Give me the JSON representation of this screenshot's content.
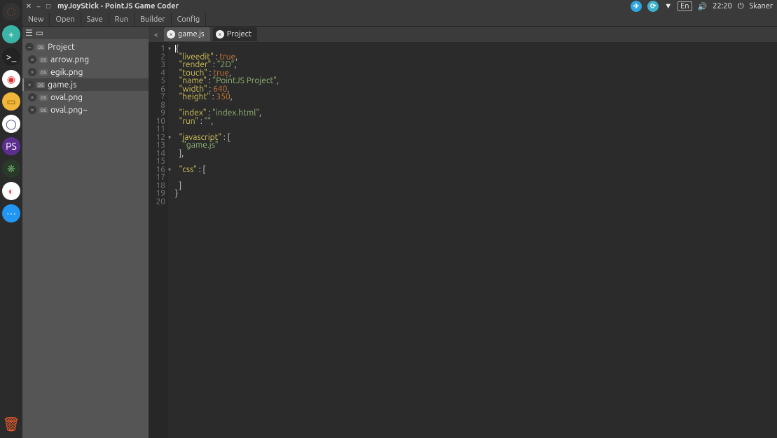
{
  "window": {
    "title": "myJoyStick - PointJS Game Coder",
    "controls": {
      "close": "✕",
      "min": "–",
      "max": "□"
    }
  },
  "system_tray": {
    "telegram_color": "#2ea6df",
    "sync_color": "#3db1c9",
    "wifi": "▾",
    "lang": "En",
    "volume": "🔊",
    "time": "22:20",
    "power": "⏻",
    "user": "Skaner"
  },
  "menubar": [
    "New",
    "Open",
    "Save",
    "Run",
    "Builder",
    "Config"
  ],
  "sidebar": {
    "toolbar": {
      "icon1": "☰",
      "icon2": "▭"
    },
    "root": "Project",
    "items": [
      {
        "name": "arrow.png",
        "badge": "os"
      },
      {
        "name": "egik.png",
        "badge": "os"
      },
      {
        "name": "game.js",
        "badge": "os",
        "active": true
      },
      {
        "name": "oval.png",
        "badge": "os"
      },
      {
        "name": "oval.png~",
        "badge": "os"
      }
    ]
  },
  "tabs": {
    "scroll_left": "<",
    "items": [
      {
        "label": "game.js",
        "active": false
      },
      {
        "label": "Project",
        "active": true
      }
    ]
  },
  "editor": {
    "lines": [
      {
        "n": 1,
        "fold": true,
        "tokens": [
          {
            "t": "{",
            "c": "p"
          }
        ],
        "cursor_before": true
      },
      {
        "n": 2,
        "tokens": [
          {
            "t": "  ",
            "c": "p"
          },
          {
            "t": "\"liveedit\"",
            "c": "k"
          },
          {
            "t": " : ",
            "c": "p"
          },
          {
            "t": "true",
            "c": "b"
          },
          {
            "t": ",",
            "c": "p"
          }
        ]
      },
      {
        "n": 3,
        "tokens": [
          {
            "t": "  ",
            "c": "p"
          },
          {
            "t": "\"render\"",
            "c": "k"
          },
          {
            "t": " : ",
            "c": "p"
          },
          {
            "t": "\"2D\"",
            "c": "s"
          },
          {
            "t": ",",
            "c": "p"
          }
        ]
      },
      {
        "n": 4,
        "tokens": [
          {
            "t": "  ",
            "c": "p"
          },
          {
            "t": "\"touch\"",
            "c": "k"
          },
          {
            "t": " : ",
            "c": "p"
          },
          {
            "t": "true",
            "c": "b"
          },
          {
            "t": ",",
            "c": "p"
          }
        ]
      },
      {
        "n": 5,
        "tokens": [
          {
            "t": "  ",
            "c": "p"
          },
          {
            "t": "\"name\"",
            "c": "k"
          },
          {
            "t": " : ",
            "c": "p"
          },
          {
            "t": "\"PointJS Project\"",
            "c": "s"
          },
          {
            "t": ",",
            "c": "p"
          }
        ]
      },
      {
        "n": 6,
        "tokens": [
          {
            "t": "  ",
            "c": "p"
          },
          {
            "t": "\"width\"",
            "c": "k"
          },
          {
            "t": " : ",
            "c": "p"
          },
          {
            "t": "640",
            "c": "b"
          },
          {
            "t": ",",
            "c": "p"
          }
        ]
      },
      {
        "n": 7,
        "tokens": [
          {
            "t": "  ",
            "c": "p"
          },
          {
            "t": "\"height\"",
            "c": "k"
          },
          {
            "t": " : ",
            "c": "p"
          },
          {
            "t": "350",
            "c": "b"
          },
          {
            "t": ",",
            "c": "p"
          }
        ]
      },
      {
        "n": 8,
        "tokens": []
      },
      {
        "n": 9,
        "tokens": [
          {
            "t": "  ",
            "c": "p"
          },
          {
            "t": "\"index\"",
            "c": "k"
          },
          {
            "t": " : ",
            "c": "p"
          },
          {
            "t": "\"index.html\"",
            "c": "s"
          },
          {
            "t": ",",
            "c": "p"
          }
        ]
      },
      {
        "n": 10,
        "tokens": [
          {
            "t": "  ",
            "c": "p"
          },
          {
            "t": "\"run\"",
            "c": "k"
          },
          {
            "t": " : ",
            "c": "p"
          },
          {
            "t": "\"\"",
            "c": "s"
          },
          {
            "t": ",",
            "c": "p"
          }
        ]
      },
      {
        "n": 11,
        "tokens": []
      },
      {
        "n": 12,
        "fold": true,
        "tokens": [
          {
            "t": "  ",
            "c": "p"
          },
          {
            "t": "\"javascript\"",
            "c": "k"
          },
          {
            "t": " : [",
            "c": "p"
          }
        ]
      },
      {
        "n": 13,
        "tokens": [
          {
            "t": "    ",
            "c": "p"
          },
          {
            "t": "\"game.js\"",
            "c": "s"
          }
        ]
      },
      {
        "n": 14,
        "tokens": [
          {
            "t": "  ],",
            "c": "p"
          }
        ]
      },
      {
        "n": 15,
        "tokens": []
      },
      {
        "n": 16,
        "fold": true,
        "tokens": [
          {
            "t": "  ",
            "c": "p"
          },
          {
            "t": "\"css\"",
            "c": "k"
          },
          {
            "t": " : [",
            "c": "p"
          }
        ]
      },
      {
        "n": 17,
        "tokens": []
      },
      {
        "n": 18,
        "tokens": [
          {
            "t": "  ]",
            "c": "p"
          }
        ]
      },
      {
        "n": 19,
        "tokens": [
          {
            "t": "}",
            "c": "p"
          }
        ]
      },
      {
        "n": 20,
        "tokens": []
      }
    ]
  },
  "launcher": {
    "items": [
      {
        "name": "ubuntu",
        "bg": "#333",
        "txt": "◌",
        "fg": "#e95420"
      },
      {
        "name": "app1",
        "bg": "#3bb4a8",
        "txt": "+",
        "fg": "#fff"
      },
      {
        "name": "terminal",
        "bg": "#222",
        "txt": ">_",
        "fg": "#fff"
      },
      {
        "name": "screenshot",
        "bg": "#fff",
        "txt": "◉",
        "fg": "#d33"
      },
      {
        "name": "files",
        "bg": "#f0b73a",
        "txt": "▭",
        "fg": "#8a5a00"
      },
      {
        "name": "chrome",
        "bg": "#fff",
        "txt": "◯",
        "fg": "#448"
      },
      {
        "name": "phpstorm",
        "bg": "#5b2e8f",
        "txt": "PS",
        "fg": "#fff"
      },
      {
        "name": "atom",
        "bg": "#2a3a2a",
        "txt": "❋",
        "fg": "#6a6"
      },
      {
        "name": "disk",
        "bg": "#fff",
        "txt": "◐",
        "fg": "#e55"
      },
      {
        "name": "more",
        "bg": "#2196f3",
        "txt": "⋯",
        "fg": "#fff"
      }
    ],
    "trash": "🗑"
  }
}
